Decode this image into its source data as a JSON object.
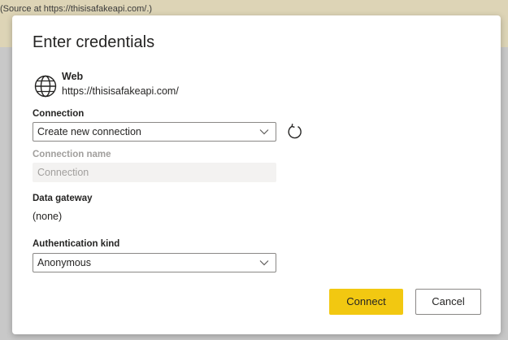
{
  "background": {
    "banner_text": "(Source at https://thisisafakeapi.com/.)"
  },
  "dialog": {
    "title": "Enter credentials",
    "source": {
      "icon": "globe-icon",
      "type": "Web",
      "url": "https://thisisafakeapi.com/"
    },
    "connection": {
      "label": "Connection",
      "value": "Create new connection",
      "refresh_icon": "refresh-icon"
    },
    "connection_name": {
      "label": "Connection name",
      "placeholder": "Connection"
    },
    "data_gateway": {
      "label": "Data gateway",
      "value": "(none)"
    },
    "authentication": {
      "label": "Authentication kind",
      "value": "Anonymous"
    },
    "buttons": {
      "connect": "Connect",
      "cancel": "Cancel"
    }
  },
  "colors": {
    "primary_button": "#f2c811",
    "banner": "#ddd4b6",
    "overlay": "#c8c8c8"
  }
}
